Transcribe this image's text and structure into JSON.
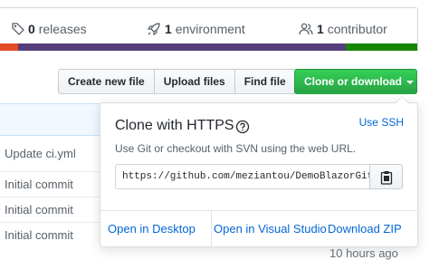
{
  "summary": {
    "releases": {
      "count": "0",
      "label": "releases",
      "icon": "tag-icon"
    },
    "environment": {
      "count": "1",
      "label": "environment",
      "icon": "rocket-icon"
    },
    "contributors": {
      "count": "1",
      "label": "contributor",
      "icon": "people-icon"
    },
    "language_colors": [
      "#e34c26",
      "#563d7c",
      "#178600"
    ]
  },
  "toolbar": {
    "create_file": "Create new file",
    "upload_files": "Upload files",
    "find_file": "Find file",
    "clone_download": "Clone or download"
  },
  "commits": [
    {
      "message": "Update ci.yml"
    },
    {
      "message": "Initial commit"
    },
    {
      "message": "Initial commit"
    },
    {
      "message": "Initial commit"
    }
  ],
  "last_row_time": "10 hours ago",
  "clone": {
    "title": "Clone with HTTPS",
    "use_ssh": "Use SSH",
    "description": "Use Git or checkout with SVN using the web URL.",
    "url": "https://github.com/meziantou/DemoBlazorGitHubPages.git",
    "open_desktop": "Open in Desktop",
    "open_vs": "Open in Visual Studio",
    "download_zip": "Download ZIP"
  },
  "colors": {
    "link": "#0366d6",
    "primary_green": "#28a745",
    "header_bg": "#f1f8ff"
  }
}
